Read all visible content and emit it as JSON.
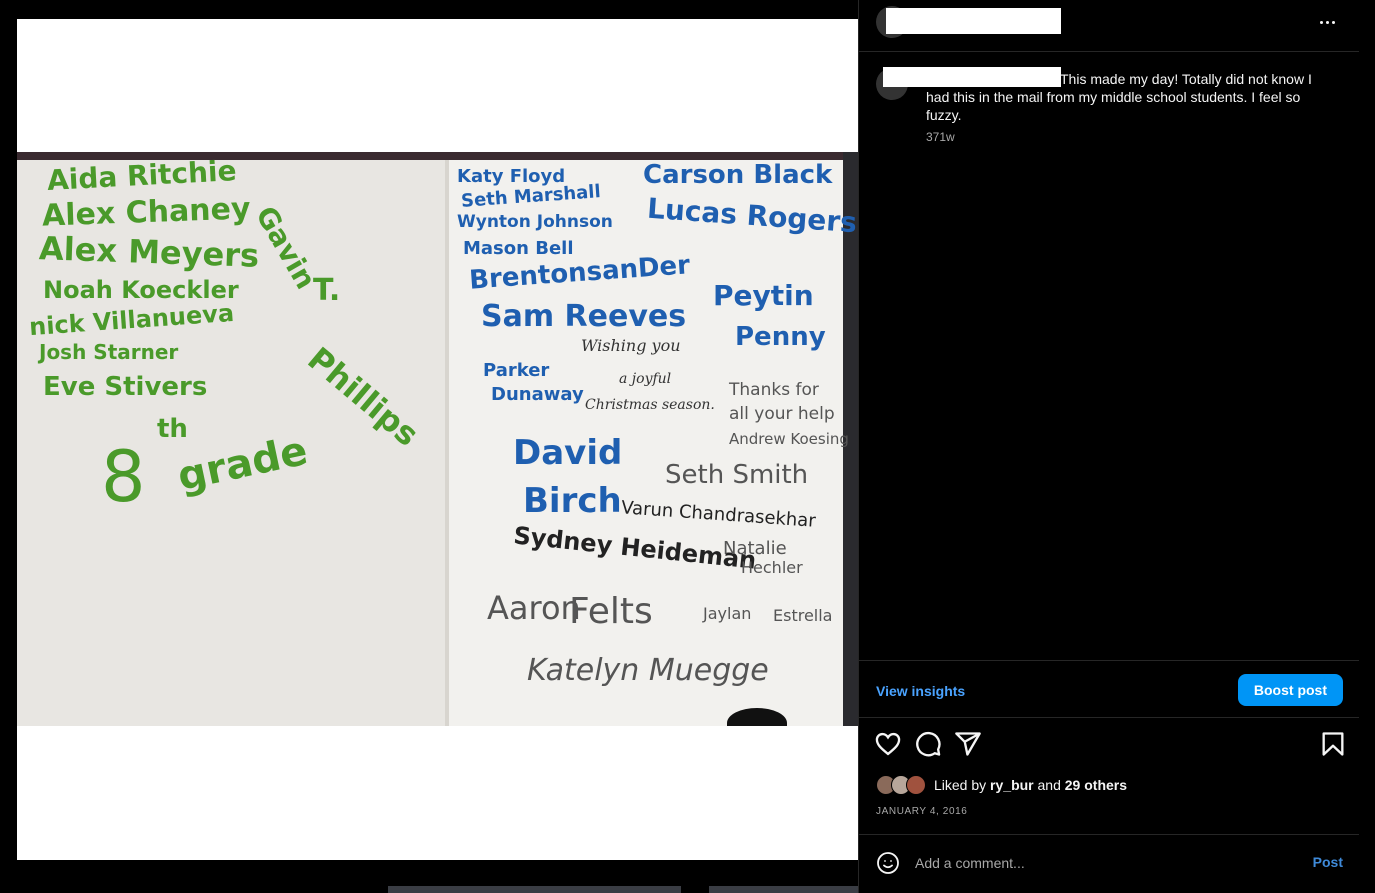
{
  "post": {
    "caption": "This made my day! Totally did not know I had this in the mail from my middle school students. I feel so fuzzy.",
    "time_ago": "371w",
    "date": "JANUARY 4, 2016"
  },
  "card": {
    "left_names": [
      "Aida Ritchie",
      "Alex Chaney",
      "Alex Meyers",
      "Noah Koeckler",
      "nick Villanueva",
      "Josh Starner",
      "Eve Stivers",
      "Gavin",
      "T.",
      "Phillips",
      "8",
      "th",
      "grade"
    ],
    "right_names": [
      "Katy Floyd",
      "Seth Marshall",
      "Wynton Johnson",
      "Mason Bell",
      "Carson Black",
      "Lucas Rogers",
      "BrentonsanDer",
      "Sam Reeves",
      "Peytin",
      "Penny",
      "Parker",
      "Dunaway",
      "David",
      "Birch",
      "Seth Smith",
      "Varun Chandrasekhar",
      "Sydney Heideman",
      "Natalie",
      "Hechler",
      "Aaron",
      "Felts",
      "Jaylan",
      "Estrella",
      "Katelyn Muegge"
    ],
    "thanks_note": [
      "Thanks for",
      "all your help",
      "Andrew Koesing"
    ],
    "printed": [
      "Wishing you",
      "a joyful",
      "Christmas season."
    ]
  },
  "actions": {
    "view_insights": "View insights",
    "boost_post": "Boost post"
  },
  "likes": {
    "prefix": "Liked by",
    "user": "ry_bur",
    "and": "and",
    "others": "29 others"
  },
  "comment": {
    "placeholder": "Add a comment...",
    "post_label": "Post"
  },
  "colors": {
    "accent": "#0095f6",
    "link": "#4aa3ff",
    "background": "#000000",
    "border": "#262626"
  },
  "icons": [
    "more-icon",
    "heart-icon",
    "comment-icon",
    "share-icon",
    "bookmark-icon",
    "emoji-icon"
  ]
}
